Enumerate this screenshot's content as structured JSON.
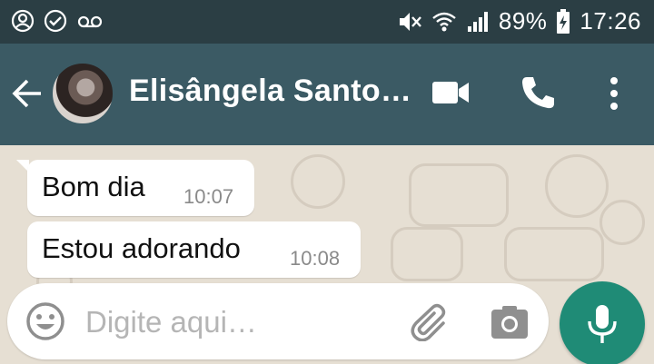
{
  "status_bar": {
    "battery_percent": "89%",
    "time": "17:26",
    "left_icons": [
      "account-circle-icon",
      "check-circle-icon",
      "voicemail-icon"
    ],
    "right_icons": [
      "mute-icon",
      "wifi-icon",
      "signal-icon",
      "battery-charging-icon"
    ]
  },
  "header": {
    "contact_name": "Elisângela Santo…",
    "icons": [
      "back-arrow-icon",
      "video-call-icon",
      "phone-icon",
      "more-vert-icon"
    ]
  },
  "messages": [
    {
      "text": "Bom dia",
      "time": "10:07",
      "direction": "incoming"
    },
    {
      "text": "Estou adorando",
      "time": "10:08",
      "direction": "incoming"
    }
  ],
  "composer": {
    "placeholder": "Digite aqui…",
    "icons": [
      "emoji-icon",
      "attach-icon",
      "camera-icon",
      "mic-icon"
    ]
  },
  "colors": {
    "status_bar_bg": "#2b3e44",
    "header_bg": "#3b5a64",
    "chat_bg": "#e6dfd3",
    "mic_button": "#1f8b76"
  }
}
